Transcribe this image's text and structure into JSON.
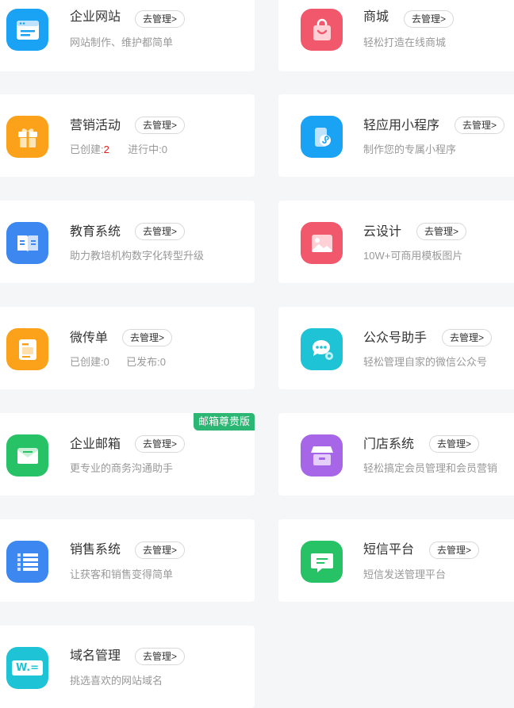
{
  "manage_label": "去管理>",
  "cards": {
    "c1": {
      "title": "企业网站",
      "desc": "网站制作、维护都简单",
      "color": "#1aa2f5"
    },
    "c2": {
      "title": "商城",
      "desc": "轻松打造在线商城",
      "color": "#f2586c"
    },
    "c3": {
      "title": "营销活动",
      "created_label": "已创建:",
      "created_value": "2",
      "running_label": "进行中:",
      "running_value": "0",
      "color": "#fba21a"
    },
    "c4": {
      "title": "轻应用小程序",
      "desc": "制作您的专属小程序",
      "color": "#1aa2f5"
    },
    "c5": {
      "title": "教育系统",
      "desc": "助力教培机构数字化转型升级",
      "color": "#3d87f0"
    },
    "c6": {
      "title": "云设计",
      "desc": "10W+可商用模板图片",
      "color": "#f2586c"
    },
    "c7": {
      "title": "微传单",
      "created_label": "已创建:",
      "created_value": "0",
      "published_label": "已发布:",
      "published_value": "0",
      "color": "#fba21a"
    },
    "c8": {
      "title": "公众号助手",
      "desc": "轻松管理自家的微信公众号",
      "color": "#1ec4d6"
    },
    "c9": {
      "title": "企业邮箱",
      "desc": "更专业的商务沟通助手",
      "badge": "邮箱尊贵版",
      "color": "#27c265"
    },
    "c10": {
      "title": "门店系统",
      "desc": "轻松搞定会员管理和会员营销",
      "color": "#a766e8"
    },
    "c11": {
      "title": "销售系统",
      "desc": "让获客和销售变得简单",
      "color": "#3d87f0"
    },
    "c12": {
      "title": "短信平台",
      "desc": "短信发送管理平台",
      "color": "#27c265"
    },
    "c13": {
      "title": "域名管理",
      "desc": "挑选喜欢的网站域名",
      "icon_text": "W.=",
      "color": "#1ec4d6"
    }
  }
}
